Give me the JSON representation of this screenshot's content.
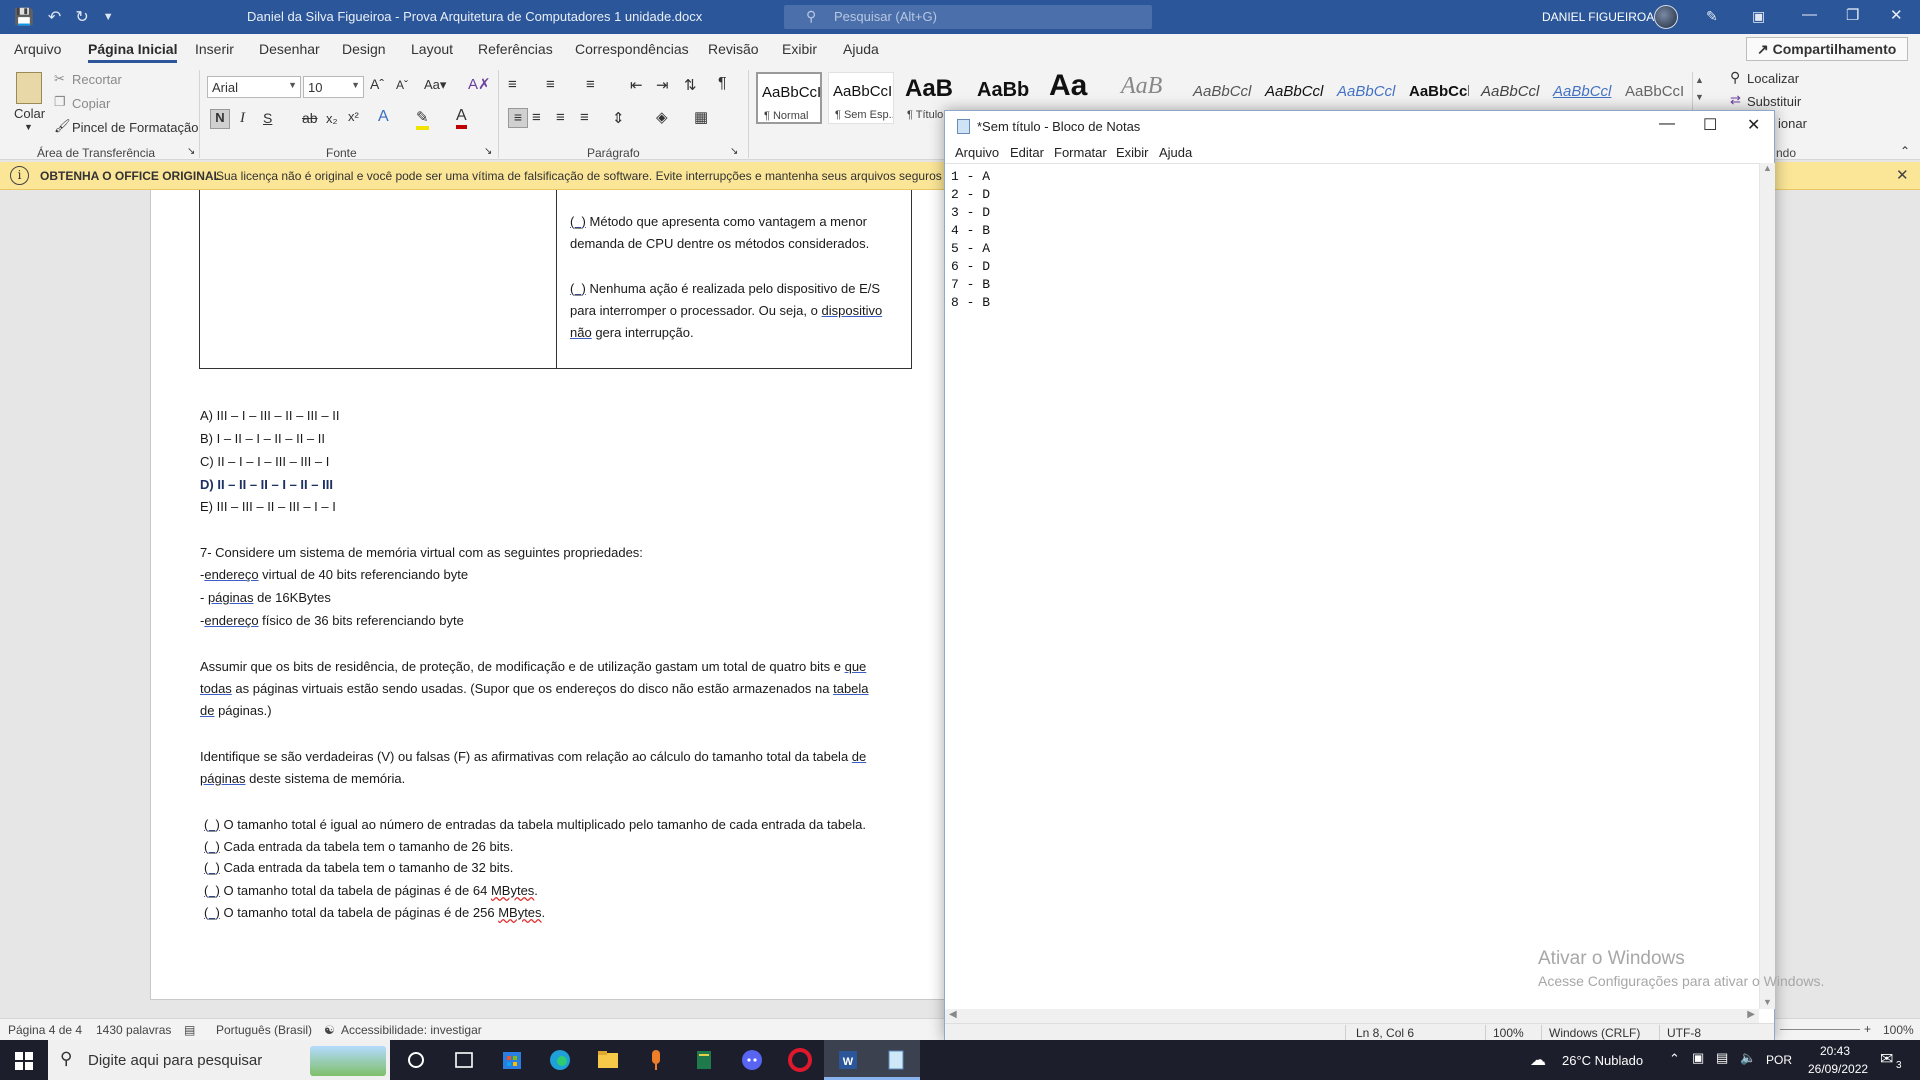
{
  "word": {
    "title": "Daniel da Silva Figueiroa - Prova Arquitetura de Computadores 1 unidade.docx",
    "search_placeholder": "Pesquisar (Alt+G)",
    "user": "DANIEL FIGUEIROA",
    "tabs": [
      "Arquivo",
      "Página Inicial",
      "Inserir",
      "Desenhar",
      "Design",
      "Layout",
      "Referências",
      "Correspondências",
      "Revisão",
      "Exibir",
      "Ajuda"
    ],
    "share_label": "Compartilhamento",
    "clipboard": {
      "paste": "Colar",
      "cut": "Recortar",
      "copy": "Copiar",
      "format_painter": "Pincel de Formatação",
      "group": "Área de Transferência"
    },
    "font": {
      "name": "Arial",
      "size": "10",
      "group": "Fonte"
    },
    "paragraph_group": "Parágrafo",
    "styles": [
      {
        "sample": "AaBbCcI",
        "name": "¶ Normal"
      },
      {
        "sample": "AaBbCcI",
        "name": "¶ Sem Esp..."
      },
      {
        "sample": "AaB",
        "name": "¶ Título"
      },
      {
        "sample": "AaBb",
        "name": ""
      },
      {
        "sample": "Aa",
        "name": ""
      },
      {
        "sample": "AaB",
        "name": ""
      },
      {
        "sample": "AaBbCcl",
        "name": ""
      },
      {
        "sample": "AaBbCcl",
        "name": ""
      },
      {
        "sample": "AaBbCcl",
        "name": ""
      },
      {
        "sample": "AaBbCcl",
        "name": ""
      },
      {
        "sample": "AaBbCcl",
        "name": ""
      },
      {
        "sample": "AaBbCcl",
        "name": ""
      },
      {
        "sample": "AaBbCcI",
        "name": ""
      }
    ],
    "editing": {
      "find": "Localizar",
      "replace": "Substituir",
      "select": "ionar",
      "group": "ndo"
    },
    "license_title": "OBTENHA O OFFICE ORIGINAL",
    "license_msg": "Sua licença não é original e você pode ser uma vítima de falsificação de software. Evite interrupções e mantenha seus arquivos seguros com",
    "status": {
      "page": "Página 4 de 4",
      "words": "1430 palavras",
      "language": "Português (Brasil)",
      "accessibility": "Accessibilidade: investigar",
      "zoom": "100%"
    }
  },
  "document": {
    "table_cell_1a": "Método que apresenta como vantagem a menor",
    "table_cell_1b": "demanda de CPU dentre os métodos considerados.",
    "table_cell_2a": "Nenhuma ação é realizada pelo dispositivo de E/S",
    "table_cell_2b": "para interromper o processador. Ou seja, o",
    "table_cell_2b_link": "dispositivo",
    "table_cell_2c_link": "não",
    "table_cell_2c": "gera interrupção.",
    "paren": "(_)",
    "options": [
      "A) III – I – III – II – III – II",
      "B) I – II – I – II – II – II",
      "C) II – I – I – III – III – I",
      "D) II – II – II – I – II – III",
      "E) III – III – II – III – I – I"
    ],
    "q7_title": "7- Considere um sistema de memória virtual com as seguintes propriedades:",
    "q7_p1_pre": "-",
    "q7_p1_link": "endereço",
    "q7_p1_post": " virtual de 40 bits referenciando byte",
    "q7_p2_pre": "- ",
    "q7_p2_link": "páginas",
    "q7_p2_post": " de 16KBytes",
    "q7_p3_pre": " -",
    "q7_p3_link": "endereço",
    "q7_p3_post": " físico de 36 bits referenciando byte",
    "para1_l1": "Assumir que os bits de residência, de proteção, de modificação e de utilização gastam um total de quatro bits e",
    "para1_l1_link": "que",
    "para1_l2_link": "todas",
    "para1_l2": " as páginas virtuais estão sendo usadas. (Supor que os endereços do disco não estão armazenados na",
    "para1_l2_link2": "tabela",
    "para1_l3_link": "de",
    "para1_l3": " páginas.)",
    "para2_l1": "Identifique se são verdadeiras (V) ou falsas (F) as afirmativas com relação ao cálculo do tamanho total da tabela",
    "para2_l1_link": "de",
    "para2_l2_link": "páginas",
    "para2_l2": " deste sistema de memória.",
    "items": [
      "O tamanho total é igual ao número de entradas da tabela multiplicado pelo tamanho de cada entrada da tabela.",
      "Cada entrada da tabela tem o tamanho de 26 bits.",
      "Cada entrada da tabela tem o tamanho de 32 bits.",
      "O tamanho total da tabela de páginas é de 64",
      "O tamanho total da tabela de páginas é de 256"
    ],
    "mbytes": "MBytes",
    "dot": "."
  },
  "notepad": {
    "title": "*Sem título - Bloco de Notas",
    "menu": [
      "Arquivo",
      "Editar",
      "Formatar",
      "Exibir",
      "Ajuda"
    ],
    "lines": [
      "1 - A",
      "2 - D",
      "3 - D",
      "4 - B",
      "5 - A",
      "6 - D",
      "7 - B",
      "8 - B"
    ],
    "status": {
      "position": "Ln 8, Col 6",
      "zoom": "100%",
      "eol": "Windows (CRLF)",
      "encoding": "UTF-8"
    },
    "activate_title": "Ativar o Windows",
    "activate_msg": "Acesse Configurações para ativar o Windows."
  },
  "taskbar": {
    "search_placeholder": "Digite aqui para pesquisar",
    "weather": "26°C  Nublado",
    "language": "POR",
    "time": "20:43",
    "date": "26/09/2022",
    "notifications": "3"
  }
}
